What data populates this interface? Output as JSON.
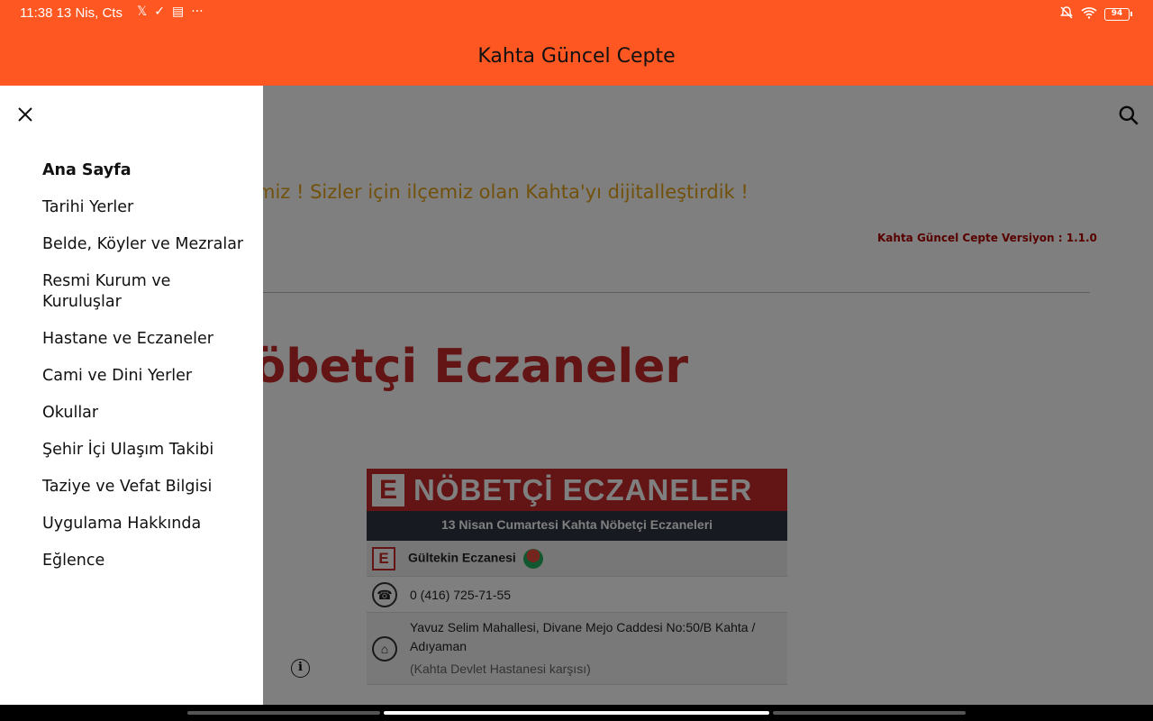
{
  "status_bar": {
    "time_date": "11:38 13 Nis, Cts",
    "icons": [
      "x-icon",
      "task-icon",
      "calendar-icon",
      "more-icon"
    ],
    "right_icons": [
      "mute-bell-icon",
      "wifi-icon",
      "battery-icon"
    ],
    "battery": "94"
  },
  "app_bar": {
    "title": "Kahta Güncel Cepte"
  },
  "page": {
    "welcome_text": "miz ! Sizler için ilçemiz olan Kahta'yı dijitalleştirdik !",
    "version_text": "Kahta Güncel Cepte Versiyon : 1.1.0",
    "heading": "Nöbetçi Eczaneler",
    "card": {
      "banner_letter": "E",
      "banner_title": "NÖBETÇİ ECZANELER",
      "subtitle": "13 Nisan Cumartesi Kahta Nöbetçi Eczaneleri",
      "pharmacy_name": "Gültekin Eczanesi",
      "phone": "0 (416) 725-71-55",
      "address": "Yavuz Selim Mahallesi, Divane Mejo Caddesi No:50/B Kahta / Adıyaman",
      "address_note": "(Kahta Devlet Hastanesi karşısı)"
    }
  },
  "drawer": {
    "items": [
      {
        "label": "Ana Sayfa",
        "active": true
      },
      {
        "label": "Tarihi Yerler"
      },
      {
        "label": "Belde, Köyler ve Mezralar"
      },
      {
        "label": "Resmi Kurum ve Kuruluşlar"
      },
      {
        "label": "Hastane ve Eczaneler"
      },
      {
        "label": "Cami ve Dini Yerler"
      },
      {
        "label": "Okullar"
      },
      {
        "label": "Şehir İçi Ulaşım Takibi"
      },
      {
        "label": "Taziye ve Vefat Bilgisi"
      },
      {
        "label": "Uygulama Hakkında"
      },
      {
        "label": "Eğlence"
      }
    ]
  },
  "colors": {
    "app_bar": "#FF5722",
    "heading": "#C62828",
    "welcome": "#E3A217"
  }
}
